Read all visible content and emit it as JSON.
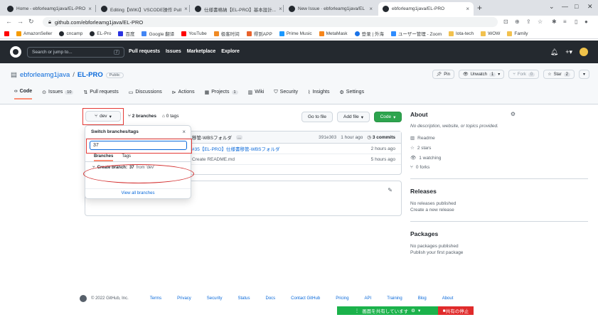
{
  "browser": {
    "tabs": [
      {
        "title": "Home - ebforleamg1java/EL-PRO",
        "active": false
      },
      {
        "title": "Editing【WIKI】VSCODE操作 Pull",
        "active": false
      },
      {
        "title": "仕様書格納【EL-PRO】基本設計...",
        "active": false
      },
      {
        "title": "New Issue · ebforleamg1java/EL",
        "active": false
      },
      {
        "title": "ebforleamg1java/EL-PRO",
        "active": true
      }
    ],
    "url": "github.com/ebforleamg1java/EL-PRO",
    "bookmarks": [
      "AmazonSeller",
      "cncamp",
      "EL-Pro",
      "百度",
      "Google 翻译",
      "YouTube",
      "极客时间",
      "得到APP",
      "Prime Music",
      "MetaMask",
      "登录 | 外海",
      "ユーザー管理 - Zoom",
      "lota-tech",
      "WOW",
      "Family"
    ]
  },
  "header": {
    "search_placeholder": "Search or jump to...",
    "search_shortcut": "/",
    "nav": [
      "Pull requests",
      "Issues",
      "Marketplace",
      "Explore"
    ]
  },
  "repo": {
    "owner": "ebforleamg1java",
    "sep": "/",
    "name": "EL-PRO",
    "visibility": "Public",
    "pin": "Pin",
    "watch": "Unwatch",
    "watch_count": "1",
    "fork": "Fork",
    "fork_count": "0",
    "star": "Star",
    "star_count": "2",
    "tabs": [
      {
        "label": "Code",
        "count": ""
      },
      {
        "label": "Issues",
        "count": "10"
      },
      {
        "label": "Pull requests",
        "count": ""
      },
      {
        "label": "Discussions",
        "count": ""
      },
      {
        "label": "Actions",
        "count": ""
      },
      {
        "label": "Projects",
        "count": "1"
      },
      {
        "label": "Wiki",
        "count": ""
      },
      {
        "label": "Security",
        "count": ""
      },
      {
        "label": "Insights",
        "count": ""
      },
      {
        "label": "Settings",
        "count": ""
      }
    ]
  },
  "branchbar": {
    "branch": "dev",
    "branches": "2 branches",
    "tags": "0 tags",
    "goto": "Go to file",
    "add": "Add file",
    "code": "Code"
  },
  "commit": {
    "msg": "移管-WBSフォルダ",
    "dots": "...",
    "sha": "391e303",
    "time": "1 hour ago",
    "commits": "3 commits"
  },
  "files": [
    {
      "msg": "#35【EL-PRO】仕様書移管-WBSフォルダ",
      "time": "2 hours ago"
    },
    {
      "msg": "Create README.md",
      "time": "5 hours ago"
    }
  ],
  "dropdown": {
    "title": "Switch branches/tags",
    "close": "×",
    "input": "37",
    "tab_branches": "Branches",
    "tab_tags": "Tags",
    "create_prefix": "Create branch:",
    "create_name": "37",
    "create_suffix": "from 'dev'",
    "view_all": "View all branches"
  },
  "about": {
    "title": "About",
    "desc": "No description, website, or topics provided.",
    "items": [
      "Readme",
      "2 stars",
      "1 watching",
      "0 forks"
    ]
  },
  "releases": {
    "title": "Releases",
    "none": "No releases published",
    "link": "Create a new release"
  },
  "packages": {
    "title": "Packages",
    "none": "No packages published",
    "link": "Publish your first package"
  },
  "footer": {
    "copy": "© 2022 GitHub, Inc.",
    "links": [
      "Terms",
      "Privacy",
      "Security",
      "Status",
      "Docs",
      "Contact GitHub",
      "Pricing",
      "API",
      "Training",
      "Blog",
      "About"
    ]
  },
  "share": {
    "sharing": "画面を共有しています",
    "stop": "共有の停止"
  }
}
